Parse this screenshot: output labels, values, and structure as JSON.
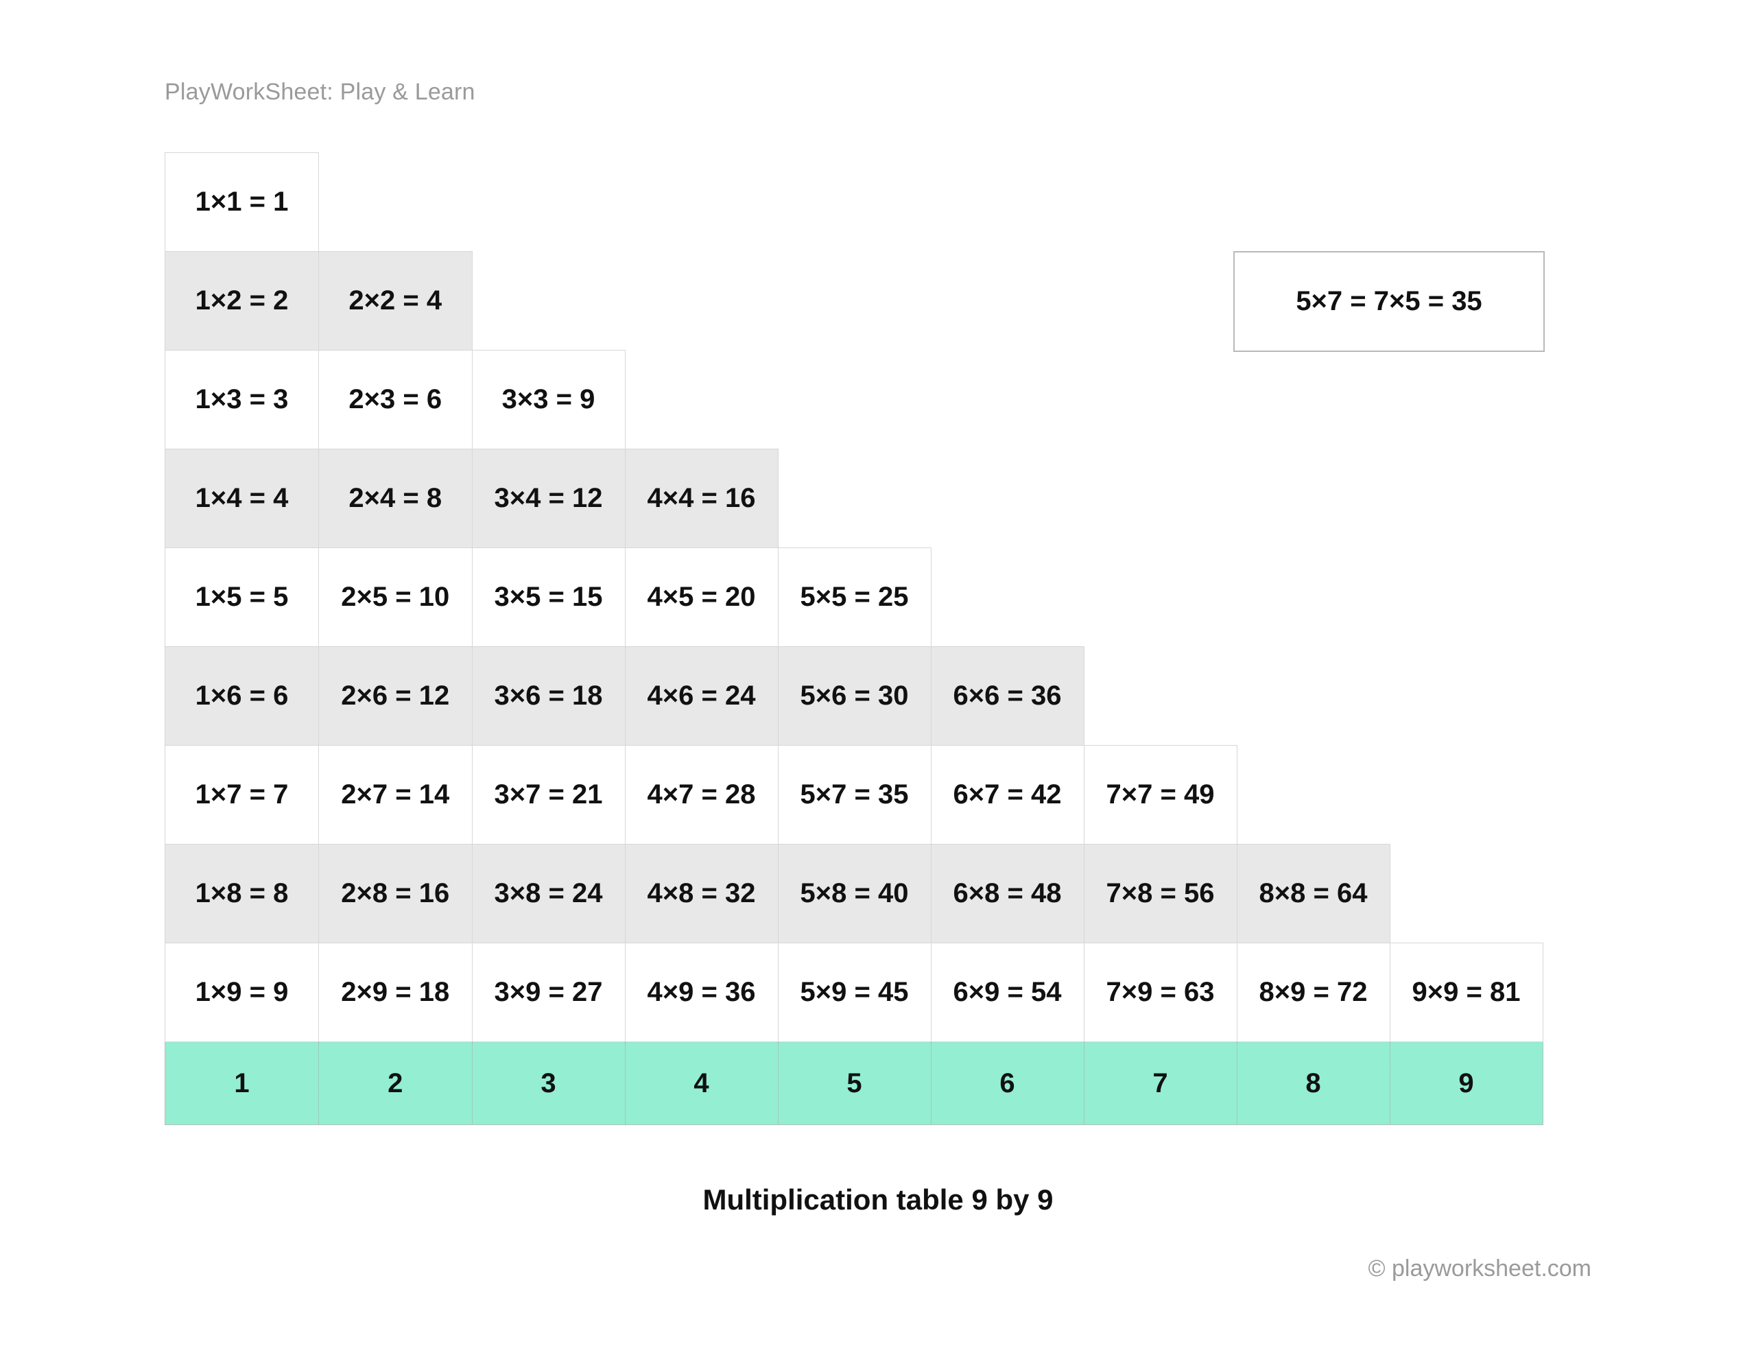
{
  "header": {
    "brand": "PlayWorkSheet: Play & Learn"
  },
  "callout": {
    "text": "5×7 = 7×5 = 35"
  },
  "table": {
    "caption": "Multiplication table 9 by 9",
    "rows": [
      [
        "1×1 = 1"
      ],
      [
        "1×2 = 2",
        "2×2 = 4"
      ],
      [
        "1×3 = 3",
        "2×3 = 6",
        "3×3 = 9"
      ],
      [
        "1×4 = 4",
        "2×4 = 8",
        "3×4 = 12",
        "4×4 = 16"
      ],
      [
        "1×5 = 5",
        "2×5 = 10",
        "3×5 = 15",
        "4×5 = 20",
        "5×5 = 25"
      ],
      [
        "1×6 = 6",
        "2×6 = 12",
        "3×6 = 18",
        "4×6 = 24",
        "5×6 = 30",
        "6×6 = 36"
      ],
      [
        "1×7 = 7",
        "2×7 = 14",
        "3×7 = 21",
        "4×7 = 28",
        "5×7 = 35",
        "6×7 = 42",
        "7×7 = 49"
      ],
      [
        "1×8 = 8",
        "2×8 = 16",
        "3×8 = 24",
        "4×8 = 32",
        "5×8 = 40",
        "6×8 = 48",
        "7×8 = 56",
        "8×8 = 64"
      ],
      [
        "1×9 = 9",
        "2×9 = 18",
        "3×9 = 27",
        "4×9 = 36",
        "5×9 = 45",
        "6×9 = 54",
        "7×9 = 63",
        "8×9 = 72",
        "9×9 = 81"
      ]
    ],
    "footer": [
      "1",
      "2",
      "3",
      "4",
      "5",
      "6",
      "7",
      "8",
      "9"
    ]
  },
  "chart_data": {
    "type": "table",
    "title": "Multiplication table 9 by 9",
    "columns": [
      1,
      2,
      3,
      4,
      5,
      6,
      7,
      8,
      9
    ],
    "values": [
      [
        1
      ],
      [
        2,
        4
      ],
      [
        3,
        6,
        9
      ],
      [
        4,
        8,
        12,
        16
      ],
      [
        5,
        10,
        15,
        20,
        25
      ],
      [
        6,
        12,
        18,
        24,
        30,
        36
      ],
      [
        7,
        14,
        21,
        28,
        35,
        42,
        49
      ],
      [
        8,
        16,
        24,
        32,
        40,
        48,
        56,
        64
      ],
      [
        9,
        18,
        27,
        36,
        45,
        54,
        63,
        72,
        81
      ]
    ],
    "identity_example": {
      "a": 5,
      "b": 7,
      "product": 35
    }
  },
  "footer": {
    "copyright": "© playworksheet.com"
  }
}
